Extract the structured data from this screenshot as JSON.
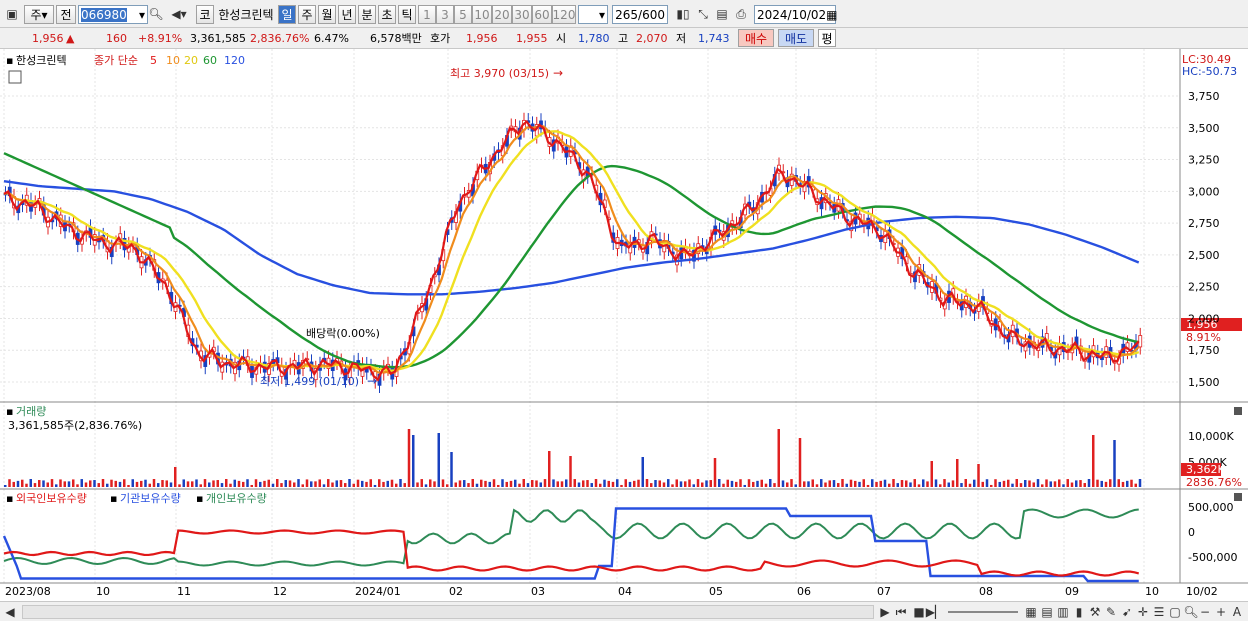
{
  "toolbar": {
    "code_type": "주",
    "period_mode": "전",
    "code": "066980",
    "stock_name": "한성크린텍",
    "tab_code": "코",
    "tabs": [
      "일",
      "주",
      "월",
      "년",
      "분",
      "초",
      "틱"
    ],
    "active_tab": "일",
    "intervals": [
      "1",
      "3",
      "5",
      "10",
      "20",
      "30",
      "60",
      "120"
    ],
    "count_current": "265",
    "count_total": "/600",
    "date": "2024/10/02"
  },
  "quote": {
    "price": "1,956",
    "change_arrow": "▲",
    "change": "160",
    "change_pct": "+8.91%",
    "volume": "3,361,585",
    "volume_pct": "2,836.76%",
    "turnover_rate": "6.47%",
    "amount": "6,578백만",
    "ask_label": "호가",
    "ask": "1,956",
    "bid": "1,955",
    "open_label": "시",
    "open": "1,780",
    "high_label": "고",
    "high": "2,070",
    "low_label": "저",
    "low": "1,743",
    "buy_label": "매수",
    "sell_label": "매도",
    "avg_label": "평"
  },
  "price_panel": {
    "name": "한성크린텍",
    "legend_prefix": "종가 단순",
    "ma_labels": [
      "5",
      "10",
      "20",
      "60",
      "120"
    ],
    "ma_colors": [
      "#e01818",
      "#f08c1c",
      "#f0e020",
      "#1e9632",
      "#2850e0"
    ],
    "lc": "LC:30.49",
    "hc": "HC:-50.73",
    "high_annotation": "최고 3,970 (03/15)",
    "low_annotation": "최저 1,499 (01/10)",
    "dividend_annotation": "배당락(0.00%)",
    "current_price_tag": "1,956",
    "current_pct_tag": "8.91%",
    "y_ticks": [
      "3,750",
      "3,500",
      "3,250",
      "3,000",
      "2,750",
      "2,500",
      "2,250",
      "2,000",
      "1,750",
      "1,500"
    ]
  },
  "volume_panel": {
    "title": "거래량",
    "value": "3,361,585주(2,836.76%)",
    "y_ticks": [
      "10,000K",
      "5,000K"
    ],
    "current_tag": "3,362K",
    "current_pct": "2836.76%"
  },
  "holdings_panel": {
    "legend": [
      "외국인보유수량",
      "기관보유수량",
      "개인보유수량"
    ],
    "legend_colors": [
      "#e01818",
      "#2850e0",
      "#2e8b57"
    ],
    "y_ticks": [
      "500,000",
      "0",
      "-500,000"
    ]
  },
  "x_axis": {
    "labels": [
      "2023/08",
      "10",
      "11",
      "12",
      "2024/01",
      "02",
      "03",
      "04",
      "05",
      "06",
      "07",
      "08",
      "09",
      "10"
    ],
    "right_label": "10/02"
  },
  "chart_data": {
    "type": "line",
    "title": "한성크린텍",
    "series": [
      {
        "name": "5",
        "values": [
          2950,
          2880,
          2700,
          2600,
          2560,
          2260,
          1720,
          1640,
          1620,
          1620,
          1640,
          1600,
          1560,
          2150,
          2900,
          3250,
          3550,
          3400,
          3150,
          2550,
          2620,
          2480,
          2650,
          2850,
          3150,
          2980,
          2800,
          2700,
          2380,
          2150,
          2100,
          1850,
          1780,
          1750,
          1690,
          1780
        ]
      },
      {
        "name": "120",
        "values": [
          3080,
          3040,
          3020,
          3000,
          2940,
          2840,
          2700,
          2500,
          2350,
          2260,
          2200,
          2190,
          2190,
          2210,
          2240,
          2280,
          2340,
          2400,
          2440,
          2470,
          2510,
          2550,
          2620,
          2700,
          2760,
          2790,
          2800,
          2790,
          2740,
          2660,
          2560,
          2440
        ]
      }
    ],
    "y_ticks": [
      "3,750",
      "3,500",
      "3,250",
      "3,000",
      "2,750",
      "2,500",
      "2,250",
      "2,000",
      "1,750",
      "1,500"
    ],
    "ylim": [
      1400,
      3900
    ],
    "high": "3,970 (03/15)",
    "low": "1,499 (01/10)"
  }
}
